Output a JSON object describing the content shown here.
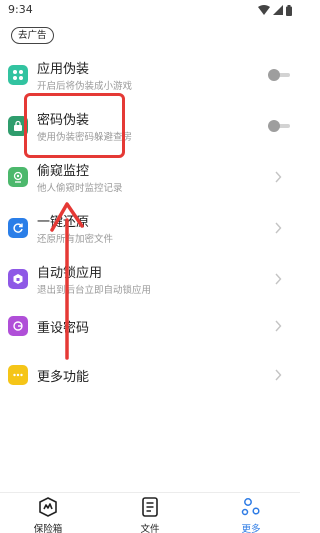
{
  "status_bar": {
    "time": "9:34"
  },
  "ad_button": {
    "label": "去广告"
  },
  "menu": {
    "items": [
      {
        "title": "应用伪装",
        "subtitle": "开启后将伪装成小游戏",
        "icon": "grid-icon",
        "color": "#32c3a0",
        "control": "toggle"
      },
      {
        "title": "密码伪装",
        "subtitle": "使用伪装密码躲避查房",
        "icon": "lock-icon",
        "color": "#2f9d6d",
        "control": "toggle"
      },
      {
        "title": "偷窥监控",
        "subtitle": "他人偷窥时监控记录",
        "icon": "eye-camera-icon",
        "color": "#4cb86c",
        "control": "chevron"
      },
      {
        "title": "一键还原",
        "subtitle": "还原所有加密文件",
        "icon": "restore-icon",
        "color": "#2a7ee8",
        "control": "chevron"
      },
      {
        "title": "自动锁应用",
        "subtitle": "退出到后台立即自动锁应用",
        "icon": "auto-lock-icon",
        "color": "#8e58e6",
        "control": "chevron"
      },
      {
        "title": "重设密码",
        "subtitle": "",
        "icon": "reset-password-icon",
        "color": "#b04fd8",
        "control": "chevron"
      },
      {
        "title": "更多功能",
        "subtitle": "",
        "icon": "more-dots-icon",
        "color": "#f5c518",
        "control": "chevron"
      }
    ]
  },
  "tabs": [
    {
      "label": "保险箱",
      "icon": "vault-icon",
      "active": false
    },
    {
      "label": "文件",
      "icon": "file-icon",
      "active": false
    },
    {
      "label": "更多",
      "icon": "more-icon",
      "active": true
    }
  ],
  "colors": {
    "accent": "#2d7be5",
    "annotation": "#e53935"
  }
}
